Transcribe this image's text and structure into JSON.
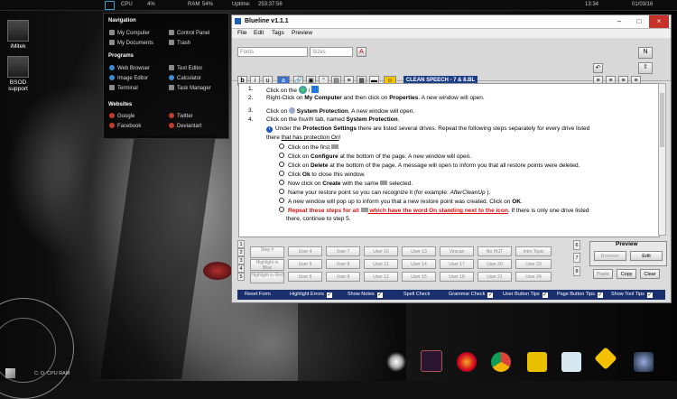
{
  "topbar": {
    "cpu_label": "CPU",
    "cpu_value": "4%",
    "ram_label": "RAM",
    "ram_value": "54%",
    "uptime_label": "Uptime:",
    "uptime_value": "253:37:56",
    "time": "13:34",
    "date": "01/03/16"
  },
  "desktop_icons": [
    {
      "label": "iMitek"
    },
    {
      "label": "BSOD support"
    }
  ],
  "start_menu": {
    "navigation_heading": "Navigation",
    "navigation": [
      "My Computer",
      "Control Panel",
      "My Documents",
      "Trash"
    ],
    "programs_heading": "Programs",
    "programs": [
      "Web Browser",
      "Text Editor",
      "Image Editor",
      "Calculator",
      "Terminal",
      "Task Manager"
    ],
    "websites_heading": "Websites",
    "websites": [
      "Google",
      "Twitter",
      "Facebook",
      "Deviantart"
    ]
  },
  "window": {
    "title": "Blueline   v1.1.1",
    "menu": [
      "File",
      "Edit",
      "Tags",
      "Preview"
    ],
    "font_placeholder": "Fonts",
    "size_placeholder": "Sizes",
    "speech_button": "CLEAN SPEECH - 7 & 8.BL",
    "format_buttons": [
      "b",
      "i",
      "u",
      "a"
    ]
  },
  "doc": {
    "l1": "Click on the",
    "l2a": "Right-Click on ",
    "l2b": "My Computer",
    "l2c": " and then click on ",
    "l2d": "Properties",
    "l2e": ". A new window will open.",
    "l3a": "Click on ",
    "l3b": "System Protection",
    "l3c": ". A new window will open.",
    "l4a": "Click on the ",
    "l4b": "fourth",
    "l4c": " tab, named ",
    "l4d": "System Protection",
    "l4e": ".",
    "l5a": "Under the ",
    "l5b": "Protection Settings",
    "l5c": " there are listed several drives.  Repeat the following steps separately for every drive listed",
    "l6a": "there ",
    "l6b": "that has protection On",
    "l6c": "!",
    "b1": "Click on the first",
    "b2a": "Click on ",
    "b2b": "Configure",
    "b2c": " at the bottom of the page. A new window will open.",
    "b3a": "Click on ",
    "b3b": "Delete",
    "b3c": " at the bottom of the page. A message will open to inform you that all restore points were deleted.",
    "b4a": "Click ",
    "b4b": "Ok",
    "b4c": " to close this window.",
    "b5a": "Now click on ",
    "b5b": "Create",
    "b5c": " with the same",
    "b5d": " selected.",
    "b6a": "Name your restore point so you can recognize it (for example: ",
    "b6b": "AfterCleanUp",
    "b6c": " ).",
    "b7a": "A new window will pop up to inform you that a new restore point was created. Click on ",
    "b7b": "OK",
    "b7c": ".",
    "b8a": "Repeat these steps for all",
    "b8b": " which have the word On standing next to the icon",
    "b8c": ". If there is only one drive listed",
    "b9": "there, continue to step 5."
  },
  "grid": {
    "row_numbers": [
      "1",
      "2",
      "3",
      "4",
      "5"
    ],
    "right_numbers": [
      "6",
      "7",
      "8"
    ],
    "rows": [
      [
        "Step #",
        "User 4",
        "User 7",
        "User 10",
        "User 13",
        "Virscan",
        "No HIJT",
        "Intro Topic"
      ],
      [
        "Highlight in Blue",
        "User 5",
        "User 8",
        "User 11",
        "User 14",
        "User 17",
        "User 20",
        "User 23"
      ],
      [
        "Highlight in Red",
        "User 6",
        "User 9",
        "User 12",
        "User 15",
        "User 18",
        "User 21",
        "User 24"
      ]
    ],
    "preview_label": "Preview",
    "browser": "Browser",
    "edit": "Edit",
    "paste": "Paste",
    "copy": "Copy",
    "clear": "Clear"
  },
  "statusbar": [
    "Reset Form",
    "Highlight Errors",
    "Show Notes",
    "Spell Check",
    "Grammar Check",
    "User Button Tips",
    "Page Button Tips",
    "Show Tool Tips"
  ],
  "taskbar": {
    "tray_text": "C:  D:  CPU  RAM"
  }
}
